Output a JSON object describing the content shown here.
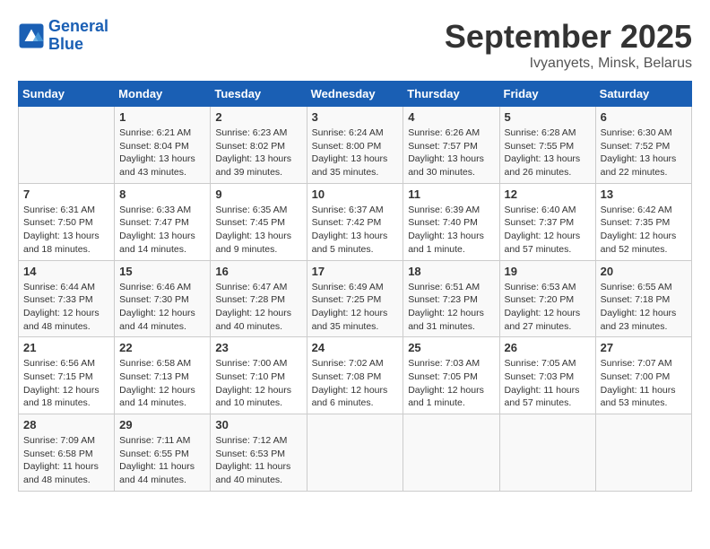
{
  "header": {
    "logo_line1": "General",
    "logo_line2": "Blue",
    "month_title": "September 2025",
    "subtitle": "Ivyanyets, Minsk, Belarus"
  },
  "days_of_week": [
    "Sunday",
    "Monday",
    "Tuesday",
    "Wednesday",
    "Thursday",
    "Friday",
    "Saturday"
  ],
  "weeks": [
    [
      {
        "day": "",
        "info": ""
      },
      {
        "day": "1",
        "info": "Sunrise: 6:21 AM\nSunset: 8:04 PM\nDaylight: 13 hours\nand 43 minutes."
      },
      {
        "day": "2",
        "info": "Sunrise: 6:23 AM\nSunset: 8:02 PM\nDaylight: 13 hours\nand 39 minutes."
      },
      {
        "day": "3",
        "info": "Sunrise: 6:24 AM\nSunset: 8:00 PM\nDaylight: 13 hours\nand 35 minutes."
      },
      {
        "day": "4",
        "info": "Sunrise: 6:26 AM\nSunset: 7:57 PM\nDaylight: 13 hours\nand 30 minutes."
      },
      {
        "day": "5",
        "info": "Sunrise: 6:28 AM\nSunset: 7:55 PM\nDaylight: 13 hours\nand 26 minutes."
      },
      {
        "day": "6",
        "info": "Sunrise: 6:30 AM\nSunset: 7:52 PM\nDaylight: 13 hours\nand 22 minutes."
      }
    ],
    [
      {
        "day": "7",
        "info": "Sunrise: 6:31 AM\nSunset: 7:50 PM\nDaylight: 13 hours\nand 18 minutes."
      },
      {
        "day": "8",
        "info": "Sunrise: 6:33 AM\nSunset: 7:47 PM\nDaylight: 13 hours\nand 14 minutes."
      },
      {
        "day": "9",
        "info": "Sunrise: 6:35 AM\nSunset: 7:45 PM\nDaylight: 13 hours\nand 9 minutes."
      },
      {
        "day": "10",
        "info": "Sunrise: 6:37 AM\nSunset: 7:42 PM\nDaylight: 13 hours\nand 5 minutes."
      },
      {
        "day": "11",
        "info": "Sunrise: 6:39 AM\nSunset: 7:40 PM\nDaylight: 13 hours\nand 1 minute."
      },
      {
        "day": "12",
        "info": "Sunrise: 6:40 AM\nSunset: 7:37 PM\nDaylight: 12 hours\nand 57 minutes."
      },
      {
        "day": "13",
        "info": "Sunrise: 6:42 AM\nSunset: 7:35 PM\nDaylight: 12 hours\nand 52 minutes."
      }
    ],
    [
      {
        "day": "14",
        "info": "Sunrise: 6:44 AM\nSunset: 7:33 PM\nDaylight: 12 hours\nand 48 minutes."
      },
      {
        "day": "15",
        "info": "Sunrise: 6:46 AM\nSunset: 7:30 PM\nDaylight: 12 hours\nand 44 minutes."
      },
      {
        "day": "16",
        "info": "Sunrise: 6:47 AM\nSunset: 7:28 PM\nDaylight: 12 hours\nand 40 minutes."
      },
      {
        "day": "17",
        "info": "Sunrise: 6:49 AM\nSunset: 7:25 PM\nDaylight: 12 hours\nand 35 minutes."
      },
      {
        "day": "18",
        "info": "Sunrise: 6:51 AM\nSunset: 7:23 PM\nDaylight: 12 hours\nand 31 minutes."
      },
      {
        "day": "19",
        "info": "Sunrise: 6:53 AM\nSunset: 7:20 PM\nDaylight: 12 hours\nand 27 minutes."
      },
      {
        "day": "20",
        "info": "Sunrise: 6:55 AM\nSunset: 7:18 PM\nDaylight: 12 hours\nand 23 minutes."
      }
    ],
    [
      {
        "day": "21",
        "info": "Sunrise: 6:56 AM\nSunset: 7:15 PM\nDaylight: 12 hours\nand 18 minutes."
      },
      {
        "day": "22",
        "info": "Sunrise: 6:58 AM\nSunset: 7:13 PM\nDaylight: 12 hours\nand 14 minutes."
      },
      {
        "day": "23",
        "info": "Sunrise: 7:00 AM\nSunset: 7:10 PM\nDaylight: 12 hours\nand 10 minutes."
      },
      {
        "day": "24",
        "info": "Sunrise: 7:02 AM\nSunset: 7:08 PM\nDaylight: 12 hours\nand 6 minutes."
      },
      {
        "day": "25",
        "info": "Sunrise: 7:03 AM\nSunset: 7:05 PM\nDaylight: 12 hours\nand 1 minute."
      },
      {
        "day": "26",
        "info": "Sunrise: 7:05 AM\nSunset: 7:03 PM\nDaylight: 11 hours\nand 57 minutes."
      },
      {
        "day": "27",
        "info": "Sunrise: 7:07 AM\nSunset: 7:00 PM\nDaylight: 11 hours\nand 53 minutes."
      }
    ],
    [
      {
        "day": "28",
        "info": "Sunrise: 7:09 AM\nSunset: 6:58 PM\nDaylight: 11 hours\nand 48 minutes."
      },
      {
        "day": "29",
        "info": "Sunrise: 7:11 AM\nSunset: 6:55 PM\nDaylight: 11 hours\nand 44 minutes."
      },
      {
        "day": "30",
        "info": "Sunrise: 7:12 AM\nSunset: 6:53 PM\nDaylight: 11 hours\nand 40 minutes."
      },
      {
        "day": "",
        "info": ""
      },
      {
        "day": "",
        "info": ""
      },
      {
        "day": "",
        "info": ""
      },
      {
        "day": "",
        "info": ""
      }
    ]
  ]
}
